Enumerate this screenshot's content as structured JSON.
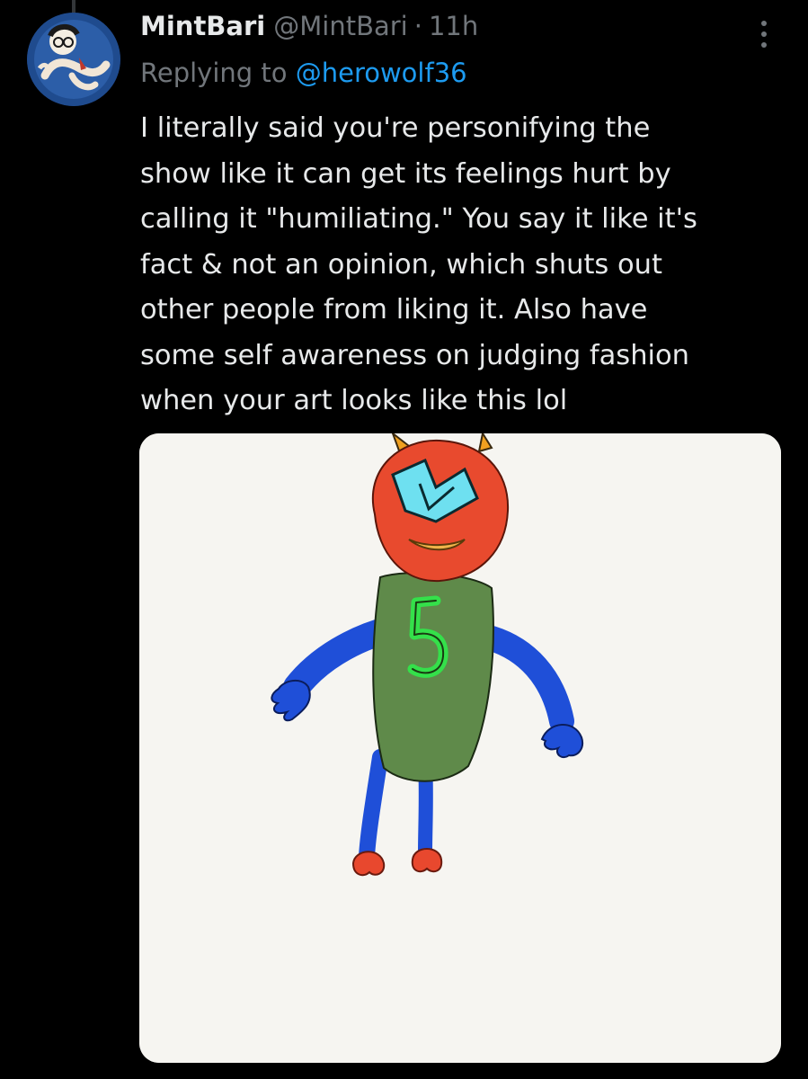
{
  "tweet": {
    "display_name": "MintBari",
    "handle": "@MintBari",
    "separator": "·",
    "time": "11h",
    "replying_prefix": "Replying to",
    "replying_to": "@herowolf36",
    "text_lines": [
      "I literally said you're personifying the",
      "show like it can get its feelings hurt by",
      "calling it \"humiliating.\" You say it like it's",
      "fact & not an opinion, which shuts out",
      "other people from liking it. Also have",
      "some self awareness on judging fashion",
      "when your art looks like this lol"
    ]
  },
  "icons": {
    "more": "more-vertical-icon",
    "avatar": "avatar-image"
  },
  "media": {
    "jersey_number": "5"
  },
  "colors": {
    "background": "#000000",
    "text": "#e7e9ea",
    "secondary_text": "#71767b",
    "link": "#1d9bf0",
    "thread_line": "#333639"
  }
}
